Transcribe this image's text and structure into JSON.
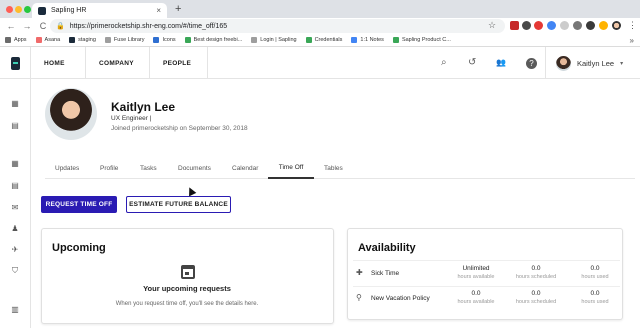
{
  "browser": {
    "tab_title": "Sapling HR",
    "tab_close": "×",
    "new_tab": "+",
    "url": "https://primerocketship.shr-eng.com/#/time_off/165",
    "lock": "🔒",
    "back": "←",
    "forward": "→",
    "reload": "C",
    "star": "☆",
    "menu": "⋮",
    "bookmarks": [
      {
        "label": "Apps",
        "color": "#6b6b6b"
      },
      {
        "label": "Asana",
        "color": "#f06a6a"
      },
      {
        "label": "staging",
        "color": "#1b2a3a"
      },
      {
        "label": "Fuse Library",
        "color": "#9e9e9e"
      },
      {
        "label": "Icons",
        "color": "#2f6fd1"
      },
      {
        "label": "Best design freebi...",
        "color": "#3aa757"
      },
      {
        "label": "Login | Sapling",
        "color": "#9e9e9e"
      },
      {
        "label": "Credentials",
        "color": "#3aa757"
      },
      {
        "label": "1:1 Notes",
        "color": "#4285f4"
      },
      {
        "label": "Sapling Product C...",
        "color": "#3aa757"
      }
    ],
    "more_bookmarks": "»"
  },
  "header": {
    "nav": [
      "HOME",
      "COMPANY",
      "PEOPLE"
    ],
    "search_glyph": "⌕",
    "history_glyph": "↺",
    "people_glyph": "👥",
    "help_glyph": "?",
    "user_name": "Kaitlyn Lee",
    "caret": "▾"
  },
  "sidebar": {
    "icons": [
      {
        "name": "dashboard-icon",
        "glyph": "▦"
      },
      {
        "name": "document-icon",
        "glyph": "▤"
      },
      {
        "name": "calendar-icon",
        "glyph": "▦"
      },
      {
        "name": "file-icon",
        "glyph": "▤"
      },
      {
        "name": "mail-icon",
        "glyph": "✉"
      },
      {
        "name": "user-add-icon",
        "glyph": "♟"
      },
      {
        "name": "plane-icon",
        "glyph": "✈"
      },
      {
        "name": "shield-icon",
        "glyph": "⛉"
      },
      {
        "name": "book-icon",
        "glyph": "▥"
      }
    ]
  },
  "profile": {
    "name": "Kaitlyn Lee",
    "title": "UX Engineer |",
    "joined": "Joined primerocketship on September 30, 2018"
  },
  "tabs": [
    "Updates",
    "Profile",
    "Tasks",
    "Documents",
    "Calendar",
    "Time Off",
    "Tables"
  ],
  "active_tab": "Time Off",
  "actions": {
    "request": "REQUEST TIME OFF",
    "estimate": "ESTIMATE FUTURE BALANCE"
  },
  "upcoming": {
    "heading": "Upcoming",
    "empty_title": "Your upcoming requests",
    "empty_subtitle": "When you request time off, you'll see the details here."
  },
  "availability": {
    "heading": "Availability",
    "rows": [
      {
        "name": "Sick Time",
        "icon": "✚",
        "available": "Unlimited",
        "available_label": "hours available",
        "scheduled": "0.0",
        "scheduled_label": "hours scheduled",
        "used": "0.0",
        "used_label": "hours used"
      },
      {
        "name": "New Vacation Policy",
        "icon": "⚲",
        "available": "0.0",
        "available_label": "hours available",
        "scheduled": "0.0",
        "scheduled_label": "hours scheduled",
        "used": "0.0",
        "used_label": "hours used"
      }
    ]
  },
  "colors": {
    "primary": "#2a1bb3",
    "brand_dark": "#1b2a3a",
    "brand_accent": "#3dd0b6"
  }
}
